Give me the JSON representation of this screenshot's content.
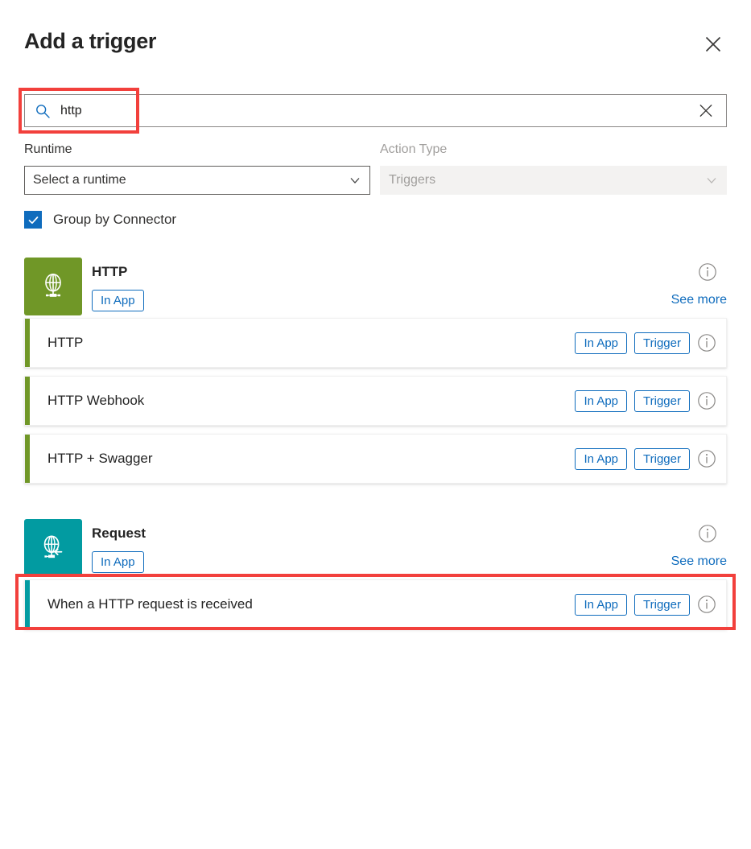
{
  "header": {
    "title": "Add a trigger",
    "close_icon": "close-icon"
  },
  "search": {
    "value": "http",
    "placeholder": "Search",
    "search_icon": "search-icon",
    "clear_icon": "close-icon"
  },
  "filters": {
    "runtime": {
      "label": "Runtime",
      "value": "Select a runtime",
      "chevron_icon": "chevron-down-icon",
      "disabled": false
    },
    "action_type": {
      "label": "Action Type",
      "value": "Triggers",
      "chevron_icon": "chevron-down-icon",
      "disabled": true
    }
  },
  "group_by_connector": {
    "label": "Group by Connector",
    "checked": true,
    "check_icon": "checkmark-icon"
  },
  "colors": {
    "accent_blue": "#0f6cbd",
    "annotation_red": "#f2403c",
    "http_green": "#709727",
    "request_teal": "#029ba1"
  },
  "connectors": [
    {
      "name": "HTTP",
      "tile_color": "#709727",
      "tile_icon": "globe-network-icon",
      "badge": "In App",
      "see_more": "See more",
      "info_icon": "info-icon",
      "operations": [
        {
          "title": "HTTP",
          "badges": [
            "In App",
            "Trigger"
          ],
          "info_icon": "info-icon",
          "accent": "#709727",
          "highlighted": false
        },
        {
          "title": "HTTP Webhook",
          "badges": [
            "In App",
            "Trigger"
          ],
          "info_icon": "info-icon",
          "accent": "#709727",
          "highlighted": false
        },
        {
          "title": "HTTP + Swagger",
          "badges": [
            "In App",
            "Trigger"
          ],
          "info_icon": "info-icon",
          "accent": "#709727",
          "highlighted": false
        }
      ]
    },
    {
      "name": "Request",
      "tile_color": "#029ba1",
      "tile_icon": "globe-request-icon",
      "badge": "In App",
      "see_more": "See more",
      "info_icon": "info-icon",
      "operations": [
        {
          "title": "When a HTTP request is received",
          "badges": [
            "In App",
            "Trigger"
          ],
          "info_icon": "info-icon",
          "accent": "#029ba1",
          "highlighted": true
        }
      ]
    }
  ]
}
